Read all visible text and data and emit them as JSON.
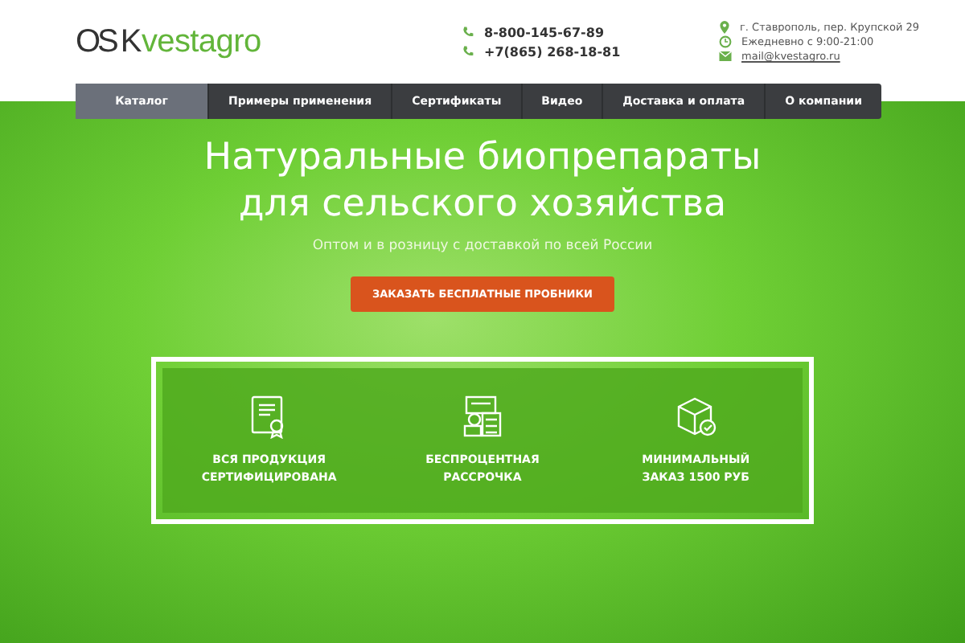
{
  "logo": {
    "mark": "OS",
    "first": "K",
    "rest": "vestagro"
  },
  "phones": [
    "8-800-145-67-89",
    "+7(865) 268-18-81"
  ],
  "contacts": [
    {
      "kind": "address",
      "text": "г. Ставрополь, пер. Крупской 29"
    },
    {
      "kind": "hours",
      "text": "Ежедневно с 9:00-21:00"
    },
    {
      "kind": "email",
      "text": "mail@kvestagro.ru"
    }
  ],
  "nav": [
    {
      "label": "Каталог",
      "selected": true
    },
    {
      "label": "Примеры применения",
      "selected": false
    },
    {
      "label": "Сертификаты",
      "selected": false
    },
    {
      "label": "Видео",
      "selected": false
    },
    {
      "label": "Доставка и оплата",
      "selected": false
    },
    {
      "label": "О компании",
      "selected": false
    }
  ],
  "hero": {
    "title_lines": [
      "Натуральные биопрепараты",
      "для сельского хозяйства"
    ],
    "subtitle": "Оптом и в розницу с доставкой по всей России",
    "button": "ЗАКАЗАТЬ БЕСПЛАТНЫЕ ПРОБНИКИ"
  },
  "features": [
    {
      "kind": "certificate",
      "lines": [
        "ВСЯ ПРОДУКЦИЯ",
        "СЕРТИФИЦИРОВАНА"
      ]
    },
    {
      "kind": "calculator",
      "lines": [
        "БЕСПРОЦЕНТНАЯ",
        "РАССРОЧКА"
      ]
    },
    {
      "kind": "box",
      "lines": [
        "МИНИМАЛЬНЫЙ",
        "ЗАКАЗ 1500 РУБ"
      ]
    }
  ]
}
